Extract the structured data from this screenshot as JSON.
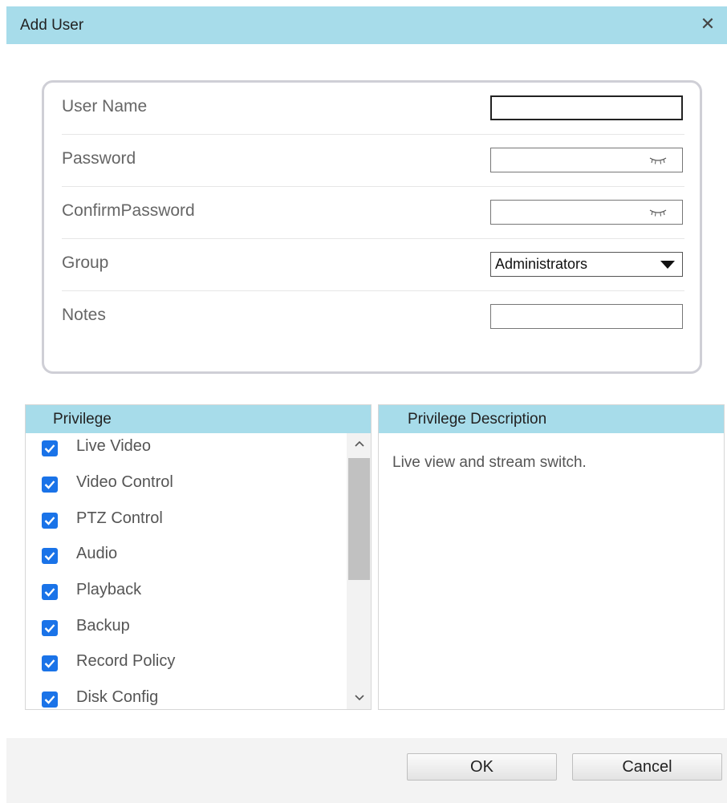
{
  "dialog": {
    "title": "Add User",
    "close_icon": "close-icon"
  },
  "form": {
    "user_name": {
      "label": "User Name",
      "value": ""
    },
    "password": {
      "label": "Password",
      "value": "",
      "icon": "eye-closed-icon"
    },
    "confirm_password": {
      "label": "ConfirmPassword",
      "value": "",
      "icon": "eye-closed-icon"
    },
    "group": {
      "label": "Group",
      "selected": "Administrators",
      "icon": "caret-down-icon"
    },
    "notes": {
      "label": "Notes",
      "value": ""
    }
  },
  "privilege": {
    "header": "Privilege",
    "items": [
      {
        "label": "Live Video",
        "checked": true
      },
      {
        "label": "Video Control",
        "checked": true
      },
      {
        "label": "PTZ Control",
        "checked": true
      },
      {
        "label": "Audio",
        "checked": true
      },
      {
        "label": "Playback",
        "checked": true
      },
      {
        "label": "Backup",
        "checked": true
      },
      {
        "label": "Record Policy",
        "checked": true
      },
      {
        "label": "Disk Config",
        "checked": true
      }
    ]
  },
  "description": {
    "header": "Privilege Description",
    "text": "Live view and stream switch."
  },
  "buttons": {
    "ok": "OK",
    "cancel": "Cancel"
  },
  "colors": {
    "header_bg": "#a7dcea",
    "checkbox": "#1a73e8"
  }
}
